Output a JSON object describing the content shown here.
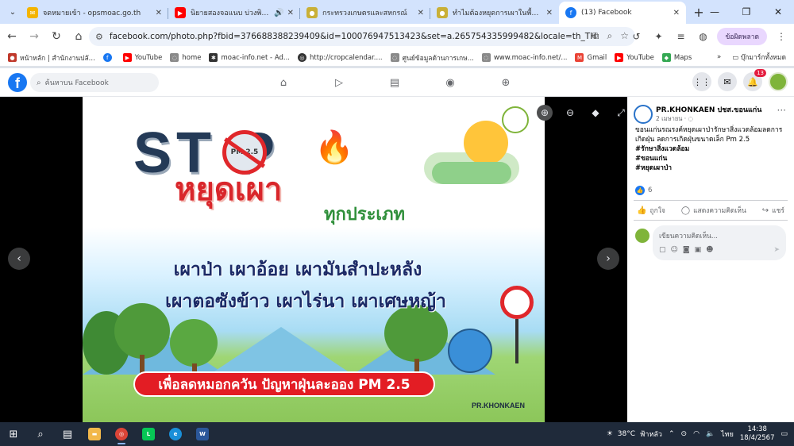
{
  "browser": {
    "tabs": [
      {
        "title": "จดหมายเข้า - opsmoac.go.th",
        "favicon_color": "#f4b400",
        "active": false
      },
      {
        "title": "นิยายสองจอแนบ บ่วงพิศวาส",
        "favicon_color": "#ff0000",
        "active": false,
        "audio": true
      },
      {
        "title": "กระทรวงเกษตรและสหกรณ์",
        "favicon_color": "#c9b037",
        "active": false
      },
      {
        "title": "ทำไมต้องหยุดการเผาในพื้นที่การเ",
        "favicon_color": "#c9b037",
        "active": false
      },
      {
        "title": "(13) Facebook",
        "favicon_color": "#1877f2",
        "active": true
      }
    ],
    "url": "facebook.com/photo.php?fbid=376688388239409&id=100076947513423&set=a.265754335999482&locale=th_TH",
    "error_pill": "ข้อผิดพลาด",
    "bookmarks": [
      {
        "label": "หน้าหลัก | สำนักงานปลั...",
        "color": "#c0392b"
      },
      {
        "label": "",
        "color": "#1877f2"
      },
      {
        "label": "YouTube",
        "color": "#ff0000"
      },
      {
        "label": "home",
        "color": "#8a8a8a"
      },
      {
        "label": "moac-info.net - Ad...",
        "color": "#333333"
      },
      {
        "label": "http://cropcalendar....",
        "color": "#333333"
      },
      {
        "label": "ศูนย์ข้อมูลด้านการเกษ...",
        "color": "#8a8a8a"
      },
      {
        "label": "www.moac-info.net/...",
        "color": "#8a8a8a"
      },
      {
        "label": "Gmail",
        "color": "#ea4335"
      },
      {
        "label": "YouTube",
        "color": "#ff0000"
      },
      {
        "label": "Maps",
        "color": "#34a853"
      }
    ],
    "all_bookmarks": "บุ๊กมาร์กทั้งหมด"
  },
  "facebook": {
    "search_placeholder": "ค้นหาบน Facebook",
    "notification_count": "13"
  },
  "poster": {
    "stop": "ST   P",
    "pm_label": "PM 2.5",
    "stop_burning": "หยุดเผา",
    "all_types": "ทุกประเภท",
    "line1": "เผาป่า เผาอ้อย เผามันสำปะหลัง",
    "line2": "เผาตอซังข้าว เผาไร่นา  เผาเศษหญ้า",
    "banner": "เพื่อลดหมอกควัน ปัญหาฝุ่นละออง PM 2.5",
    "credit": "PR.KHONKAEN"
  },
  "post": {
    "page_name": "PR.KHONKAEN ปชส.ขอนแก่น",
    "date": "2 เมษายน · ",
    "body": "ขอนแก่นรณรงค์หยุดเผาป่ารักษาสิ่งแวดล้อมลดการเกิดฝุ่น ลดการเกิดฝุ่นขนาดเล็ก Pm 2.5",
    "tags": [
      "#รักษาสิ่งแวดล้อม",
      "#ขอนแก่น",
      "#หยุดเผาป่า"
    ],
    "like_count": "6",
    "like_label": "ถูกใจ",
    "comment_label": "แสดงความคิดเห็น",
    "share_label": "แชร์",
    "comment_placeholder": "เขียนความคิดเห็น..."
  },
  "taskbar": {
    "temperature": "38°C",
    "weather_text": "ฟ้าหลัว",
    "lang": "ไทย",
    "time": "14:38",
    "date": "18/4/2567"
  }
}
